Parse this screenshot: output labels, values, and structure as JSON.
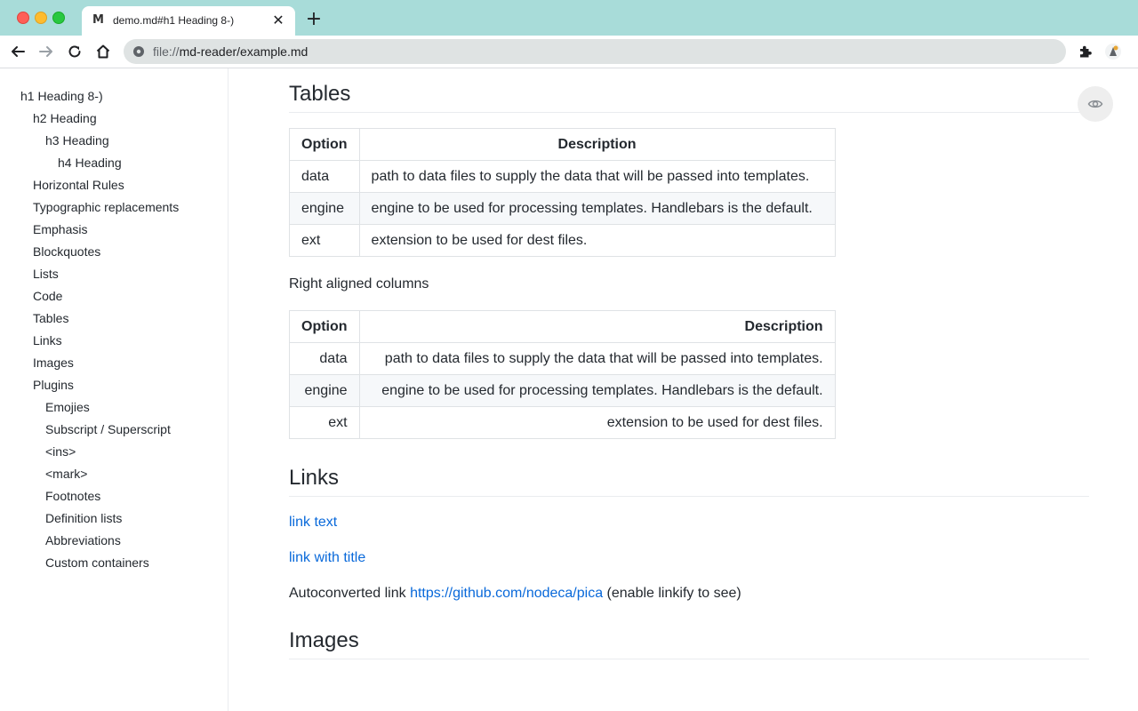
{
  "browser": {
    "tab": {
      "title": "demo.md#h1 Heading 8-)",
      "favicon": "M"
    },
    "url": {
      "scheme": "file://",
      "rest": "md-reader/example.md"
    }
  },
  "toc": [
    {
      "label": "h1 Heading 8-)"
    },
    {
      "label": "h2 Heading"
    },
    {
      "label": "h3 Heading"
    },
    {
      "label": "h4 Heading"
    },
    {
      "label": "Horizontal Rules"
    },
    {
      "label": "Typographic replacements"
    },
    {
      "label": "Emphasis"
    },
    {
      "label": "Blockquotes"
    },
    {
      "label": "Lists"
    },
    {
      "label": "Code"
    },
    {
      "label": "Tables"
    },
    {
      "label": "Links"
    },
    {
      "label": "Images"
    },
    {
      "label": "Plugins"
    },
    {
      "label": "Emojies"
    },
    {
      "label": "Subscript / Superscript"
    },
    {
      "label": "<ins>"
    },
    {
      "label": "<mark>"
    },
    {
      "label": "Footnotes"
    },
    {
      "label": "Definition lists"
    },
    {
      "label": "Abbreviations"
    },
    {
      "label": "Custom containers"
    }
  ],
  "content": {
    "tables_heading": "Tables",
    "table1": {
      "headers": [
        "Option",
        "Description"
      ],
      "rows": [
        [
          "data",
          "path to data files to supply the data that will be passed into templates."
        ],
        [
          "engine",
          "engine to be used for processing templates. Handlebars is the default."
        ],
        [
          "ext",
          "extension to be used for dest files."
        ]
      ]
    },
    "right_aligned_text": "Right aligned columns",
    "table2": {
      "headers": [
        "Option",
        "Description"
      ],
      "rows": [
        [
          "data",
          "path to data files to supply the data that will be passed into templates."
        ],
        [
          "engine",
          "engine to be used for processing templates. Handlebars is the default."
        ],
        [
          "ext",
          "extension to be used for dest files."
        ]
      ]
    },
    "links_heading": "Links",
    "link_text": "link text",
    "link_with_title": "link with title",
    "autolink_prefix": "Autoconverted link ",
    "autolink_url": "https://github.com/nodeca/pica",
    "autolink_suffix": " (enable linkify to see)",
    "images_heading": "Images"
  },
  "colors": {
    "tabbar": "#a8dcd9",
    "link": "#0969da"
  }
}
